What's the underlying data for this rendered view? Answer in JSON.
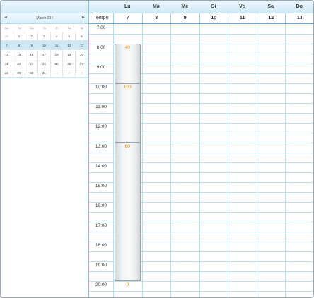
{
  "mini_calendar": {
    "prev_icon": "◄",
    "next_icon": "►",
    "title": "March 23 l",
    "dow": [
      "Mo",
      "Tu",
      "We",
      "Th",
      "Fr",
      "Sa",
      "Su"
    ],
    "weeks": [
      [
        "28",
        "1",
        "2",
        "3",
        "4",
        "5",
        "6"
      ],
      [
        "7",
        "8",
        "9",
        "10",
        "11",
        "12",
        "13"
      ],
      [
        "14",
        "15",
        "16",
        "17",
        "18",
        "19",
        "20"
      ],
      [
        "21",
        "22",
        "23",
        "24",
        "25",
        "26",
        "27"
      ],
      [
        "28",
        "29",
        "30",
        "31",
        "1",
        "2",
        "3"
      ]
    ],
    "selected_week_index": 1
  },
  "schedule": {
    "days": [
      "Lu",
      "Ma",
      "Me",
      "Gi",
      "Ve",
      "Sa",
      "Do"
    ],
    "dates": [
      "7",
      "8",
      "9",
      "10",
      "11",
      "12",
      "13"
    ],
    "time_header": "Tempo",
    "times": [
      "7:00",
      "8:00",
      "9:00",
      "10:00",
      "11:00",
      "12:00",
      "13:00",
      "14:00",
      "15:00",
      "16:00",
      "17:00",
      "18:00",
      "19:00",
      "20:00"
    ],
    "events": [
      {
        "label": "40"
      },
      {
        "label": "100"
      },
      {
        "label": "60"
      },
      {
        "label": "0"
      }
    ]
  },
  "colors": {
    "grid_line": "#b8def2",
    "event_value": "#e08a00"
  }
}
